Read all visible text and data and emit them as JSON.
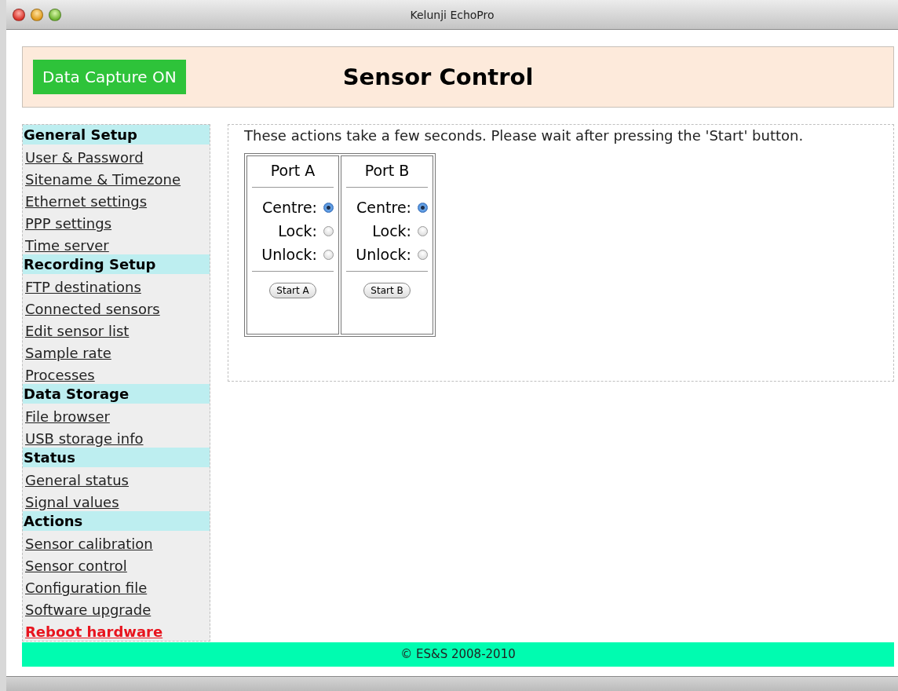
{
  "window": {
    "title": "Kelunji EchoPro"
  },
  "header": {
    "capture_badge": "Data Capture ON",
    "title": "Sensor Control"
  },
  "sidebar": {
    "sections": [
      {
        "heading": "General Setup",
        "items": [
          {
            "label": "User & Password",
            "kind": "normal"
          },
          {
            "label": "Sitename & Timezone",
            "kind": "normal"
          },
          {
            "label": "Ethernet settings",
            "kind": "normal"
          },
          {
            "label": "PPP settings",
            "kind": "normal"
          },
          {
            "label": "Time server",
            "kind": "normal"
          }
        ]
      },
      {
        "heading": "Recording Setup",
        "items": [
          {
            "label": "FTP destinations",
            "kind": "normal"
          },
          {
            "label": "Connected sensors",
            "kind": "normal"
          },
          {
            "label": "Edit sensor list",
            "kind": "normal"
          },
          {
            "label": "Sample rate",
            "kind": "normal"
          },
          {
            "label": "Processes",
            "kind": "normal"
          }
        ]
      },
      {
        "heading": "Data Storage",
        "items": [
          {
            "label": "File browser",
            "kind": "normal"
          },
          {
            "label": "USB storage info",
            "kind": "normal"
          }
        ]
      },
      {
        "heading": "Status",
        "items": [
          {
            "label": "General status",
            "kind": "normal"
          },
          {
            "label": "Signal values",
            "kind": "normal"
          }
        ]
      },
      {
        "heading": "Actions",
        "items": [
          {
            "label": "Sensor calibration",
            "kind": "normal"
          },
          {
            "label": "Sensor control",
            "kind": "normal"
          },
          {
            "label": "Configuration file",
            "kind": "normal"
          },
          {
            "label": "Software upgrade",
            "kind": "normal"
          },
          {
            "label": "Reboot hardware",
            "kind": "danger"
          }
        ]
      }
    ]
  },
  "main": {
    "notice": "These actions take a few seconds. Please wait after pressing the 'Start' button.",
    "ports": [
      {
        "title": "Port A",
        "options": [
          {
            "label": "Centre:",
            "selected": true
          },
          {
            "label": "Lock:",
            "selected": false
          },
          {
            "label": "Unlock:",
            "selected": false
          }
        ],
        "button": "Start A"
      },
      {
        "title": "Port B",
        "options": [
          {
            "label": "Centre:",
            "selected": true
          },
          {
            "label": "Lock:",
            "selected": false
          },
          {
            "label": "Unlock:",
            "selected": false
          }
        ],
        "button": "Start B"
      }
    ]
  },
  "footer": "© ES&S 2008-2010"
}
